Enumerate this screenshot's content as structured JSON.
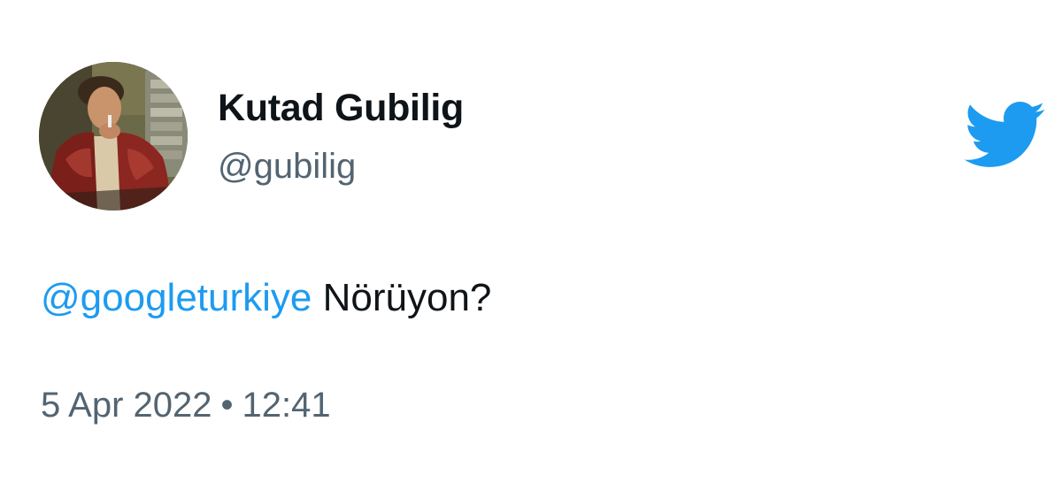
{
  "tweet": {
    "author": {
      "display_name": "Kutad Gubilig",
      "handle": "@gubilig",
      "avatar_icon": "profile-photo"
    },
    "logo_icon": "twitter-bird-icon",
    "body": {
      "mention": "@googleturkiye",
      "text": " Nörüyon?"
    },
    "date": "5 Apr 2022",
    "separator": "•",
    "time": "12:41"
  },
  "colors": {
    "accent": "#1d9bf0",
    "text": "#0f1419",
    "muted": "#536471",
    "background": "#ffffff"
  }
}
